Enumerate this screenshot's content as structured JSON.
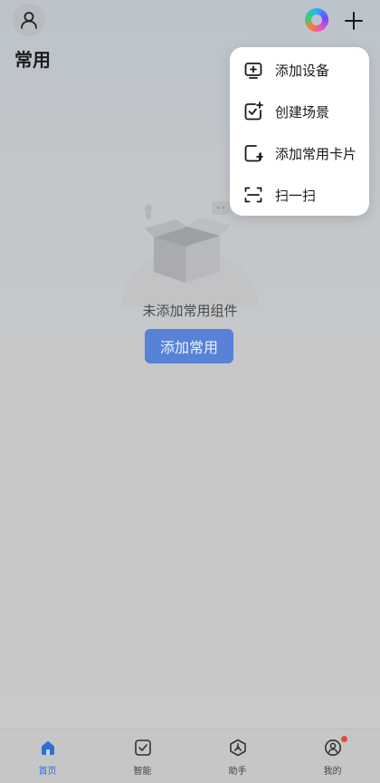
{
  "page": {
    "title": "常用"
  },
  "empty_state": {
    "message": "未添加常用组件",
    "add_button_label": "添加常用"
  },
  "add_menu": {
    "items": [
      {
        "label": "添加设备",
        "icon": "add-device-icon"
      },
      {
        "label": "创建场景",
        "icon": "create-scene-icon"
      },
      {
        "label": "添加常用卡片",
        "icon": "add-card-icon"
      },
      {
        "label": "扫一扫",
        "icon": "scan-icon"
      }
    ]
  },
  "tabs": [
    {
      "label": "首页",
      "icon": "home-icon",
      "active": true
    },
    {
      "label": "智能",
      "icon": "smart-icon",
      "active": false
    },
    {
      "label": "助手",
      "icon": "assistant-icon",
      "active": false
    },
    {
      "label": "我的",
      "icon": "profile-icon",
      "active": false,
      "badge": true
    }
  ],
  "colors": {
    "accent": "#2d6fd6",
    "button": "#5782d6",
    "badge": "#e54a3b"
  }
}
